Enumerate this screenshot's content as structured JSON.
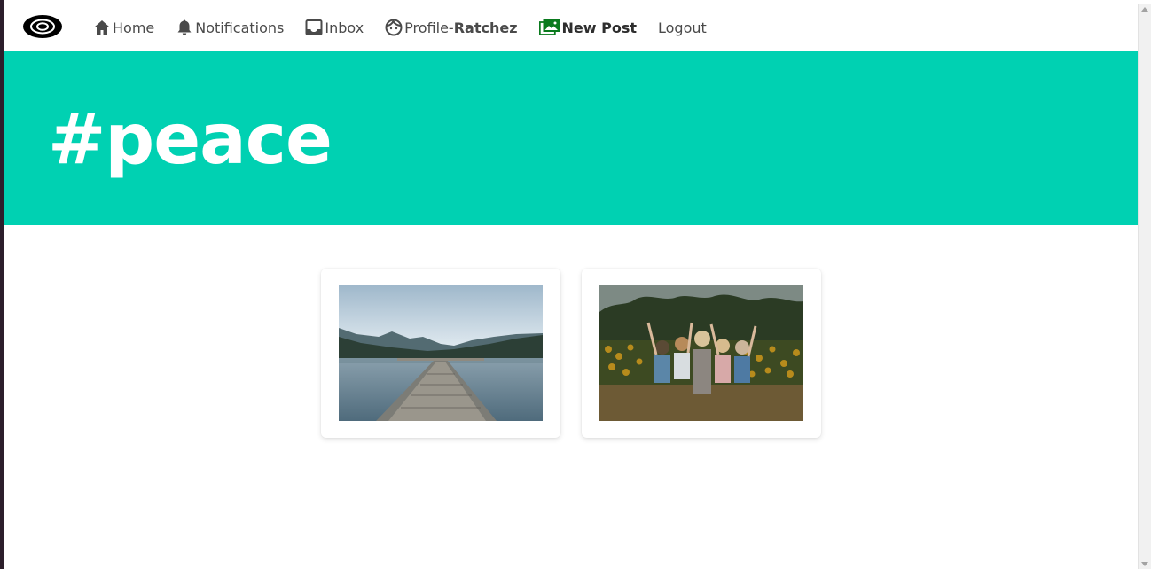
{
  "navbar": {
    "logo_icon": "logo-eye-icon",
    "items": [
      {
        "label": "Home",
        "icon": "home-icon"
      },
      {
        "label": "Notifications",
        "icon": "bell-icon"
      },
      {
        "label": "Inbox",
        "icon": "inbox-icon"
      },
      {
        "label_prefix": "Profile-",
        "label_user": "Ratchez",
        "icon": "face-icon"
      },
      {
        "label": "New Post",
        "icon": "image-upload-icon"
      },
      {
        "label": "Logout"
      }
    ]
  },
  "hero": {
    "title": "#peace",
    "color": "#00d1b2"
  },
  "posts": [
    {
      "image": "lake-dock-photo"
    },
    {
      "image": "sunflower-friends-photo"
    }
  ]
}
